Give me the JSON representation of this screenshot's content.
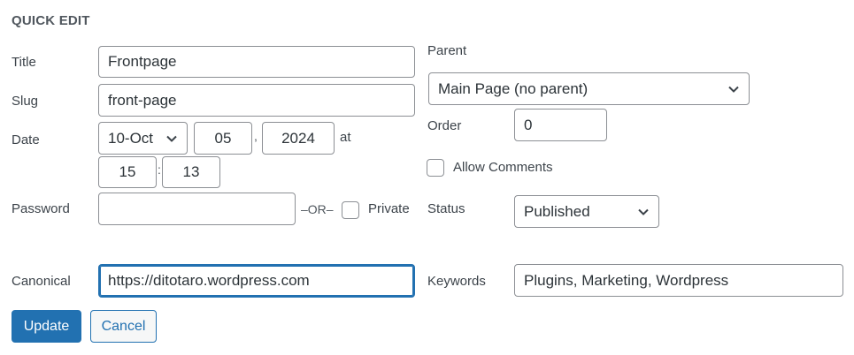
{
  "heading": "QUICK EDIT",
  "fields": {
    "title_label": "Title",
    "title_value": "Frontpage",
    "slug_label": "Slug",
    "slug_value": "front-page",
    "date_label": "Date",
    "month_value": "10-Oct",
    "day_value": "05",
    "day_sep": ",",
    "year_value": "2024",
    "at_label": "at",
    "hour_value": "15",
    "time_sep": ":",
    "minute_value": "13",
    "password_label": "Password",
    "password_value": "",
    "or_label": "–OR–",
    "private_label": "Private",
    "canonical_label": "Canonical",
    "canonical_value": "https://ditotaro.wordpress.com"
  },
  "right": {
    "parent_label": "Parent",
    "parent_value": "Main Page (no parent)",
    "order_label": "Order",
    "order_value": "0",
    "allow_comments_label": "Allow Comments",
    "status_label": "Status",
    "status_value": "Published",
    "keywords_label": "Keywords",
    "keywords_value": "Plugins, Marketing, Wordpress"
  },
  "buttons": {
    "update_label": "Update",
    "cancel_label": "Cancel"
  },
  "colors": {
    "accent": "#2271b1",
    "border": "#8c8f94",
    "text": "#3c434a"
  },
  "icons": {
    "select_chevron": "chevron-down-icon"
  }
}
